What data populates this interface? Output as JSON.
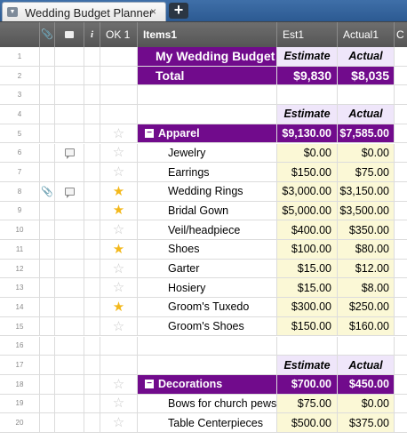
{
  "tab": {
    "title": "Wedding Budget Planner",
    "close": "×",
    "add": "+",
    "menu": "▼"
  },
  "columns": {
    "ok": "OK 1",
    "items": "Items1",
    "est": "Est1",
    "actual": "Actual1",
    "extra": "C",
    "info": "i"
  },
  "rows": [
    {
      "num": "1",
      "item": "My Wedding Budget",
      "est": "Estimate",
      "act": "Actual",
      "style": "title"
    },
    {
      "num": "2",
      "item": "Total",
      "est": "$9,830",
      "act": "$8,035",
      "style": "total"
    },
    {
      "num": "3",
      "style": "blank"
    },
    {
      "num": "4",
      "est": "Estimate",
      "act": "Actual",
      "style": "subhead"
    },
    {
      "num": "5",
      "item": "Apparel",
      "est": "$9,130.00",
      "act": "$7,585.00",
      "style": "group",
      "star": false
    },
    {
      "num": "6",
      "item": "Jewelry",
      "est": "$0.00",
      "act": "$0.00",
      "style": "item",
      "star": false,
      "comment": true
    },
    {
      "num": "7",
      "item": "Earrings",
      "est": "$150.00",
      "act": "$75.00",
      "style": "item",
      "star": false
    },
    {
      "num": "8",
      "item": "Wedding Rings",
      "est": "$3,000.00",
      "act": "$3,150.00",
      "style": "item",
      "star": true,
      "comment": true,
      "attach": true
    },
    {
      "num": "9",
      "item": "Bridal Gown",
      "est": "$5,000.00",
      "act": "$3,500.00",
      "style": "item",
      "star": true
    },
    {
      "num": "10",
      "item": "Veil/headpiece",
      "est": "$400.00",
      "act": "$350.00",
      "style": "item",
      "star": false
    },
    {
      "num": "11",
      "item": "Shoes",
      "est": "$100.00",
      "act": "$80.00",
      "style": "item",
      "star": true
    },
    {
      "num": "12",
      "item": "Garter",
      "est": "$15.00",
      "act": "$12.00",
      "style": "item",
      "star": false
    },
    {
      "num": "13",
      "item": "Hosiery",
      "est": "$15.00",
      "act": "$8.00",
      "style": "item",
      "star": false
    },
    {
      "num": "14",
      "item": "Groom's Tuxedo",
      "est": "$300.00",
      "act": "$250.00",
      "style": "item",
      "star": true
    },
    {
      "num": "15",
      "item": "Groom's Shoes",
      "est": "$150.00",
      "act": "$160.00",
      "style": "item",
      "star": false
    },
    {
      "num": "16",
      "style": "blank"
    },
    {
      "num": "17",
      "est": "Estimate",
      "act": "Actual",
      "style": "subhead"
    },
    {
      "num": "18",
      "item": "Decorations",
      "est": "$700.00",
      "act": "$450.00",
      "style": "group",
      "star": false
    },
    {
      "num": "19",
      "item": "Bows for church pews",
      "est": "$75.00",
      "act": "$0.00",
      "style": "item",
      "star": false
    },
    {
      "num": "20",
      "item": "Table Centerpieces",
      "est": "$500.00",
      "act": "$375.00",
      "style": "item",
      "star": false
    }
  ],
  "colors": {
    "purple": "#710b8c",
    "lavender": "#efe6fa",
    "cellYellow": "#fbf8d6",
    "starOn": "#f3b81b"
  }
}
